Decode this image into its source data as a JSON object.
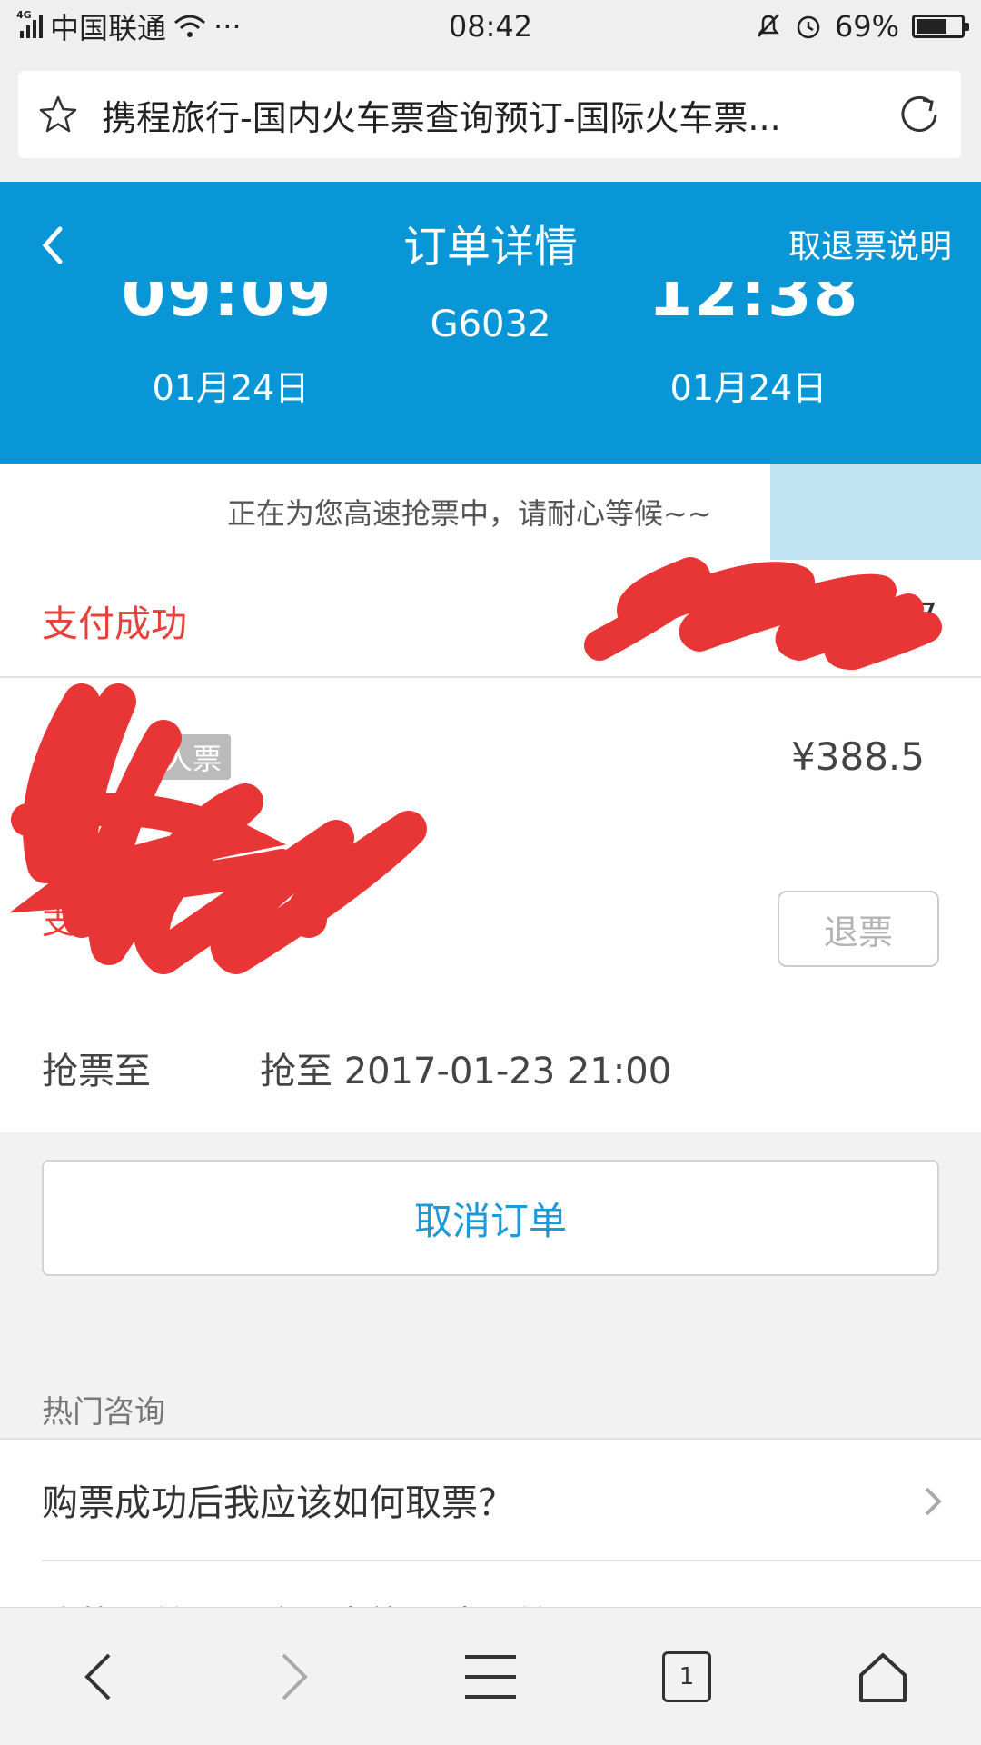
{
  "status_bar": {
    "network_type": "4G",
    "carrier": "中国联通",
    "more": "···",
    "time": "08:42",
    "battery": "69%",
    "battery_level": 0.69
  },
  "browser": {
    "url_title": "携程旅行-国内火车票查询预订-国际火车票..."
  },
  "header": {
    "title": "订单详情",
    "refund_info": "取退票说明",
    "departure_time": "09:09",
    "departure_date": "01月24日",
    "train_number": "G6032",
    "arrival_time": "12:38",
    "arrival_date": "01月24日"
  },
  "notice": {
    "text": "正在为您高速抢票中，请耐心等候~~"
  },
  "order": {
    "status": "支付成功",
    "order_number_tail": "7"
  },
  "ticket": {
    "type_badge": "人票",
    "price": "¥388.5",
    "pay_label": "支付时间",
    "refund_button": "退票",
    "grab_label": "抢票至",
    "grab_value": "抢至 2017-01-23 21:00"
  },
  "actions": {
    "cancel_order": "取消订单"
  },
  "faq": {
    "title": "热门咨询",
    "items": [
      "购票成功后我应该如何取票？",
      "我的订单显示购票中能取消订单吗？"
    ]
  },
  "bottom_nav": {
    "tab_count": "1"
  },
  "colors": {
    "header_blue": "#0996d6",
    "status_red": "#e5413a",
    "link_blue": "#1a9ad6"
  }
}
